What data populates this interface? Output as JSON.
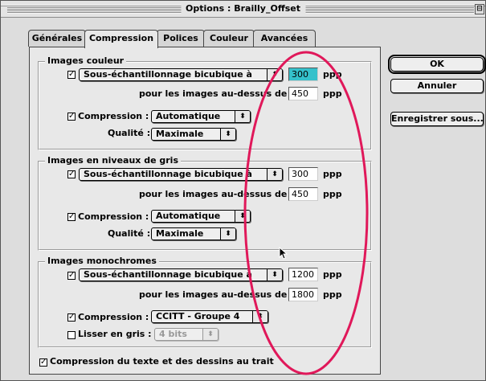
{
  "window": {
    "title": "Options : Brailly_Offset",
    "zoom_glyph": "⊟"
  },
  "tabs": [
    {
      "label": "Générales"
    },
    {
      "label": "Compression",
      "active": true
    },
    {
      "label": "Polices"
    },
    {
      "label": "Couleur"
    },
    {
      "label": "Avancées"
    }
  ],
  "color_images": {
    "title": "Images couleur",
    "resample_method": "Sous-échantillonnage bicubique à",
    "resample_value": "300",
    "unit": "ppp",
    "threshold_label": "pour les images au-dessus de :",
    "threshold_value": "450",
    "compression_label": "Compression :",
    "compression_value": "Automatique",
    "quality_label": "Qualité :",
    "quality_value": "Maximale"
  },
  "gray_images": {
    "title": "Images en niveaux de gris",
    "resample_method": "Sous-échantillonnage bicubique à",
    "resample_value": "300",
    "unit": "ppp",
    "threshold_label": "pour les images au-dessus de :",
    "threshold_value": "450",
    "compression_label": "Compression :",
    "compression_value": "Automatique",
    "quality_label": "Qualité :",
    "quality_value": "Maximale"
  },
  "mono_images": {
    "title": "Images monochromes",
    "resample_method": "Sous-échantillonnage bicubique à",
    "resample_value": "1200",
    "unit": "ppp",
    "threshold_label": "pour les images au-dessus de :",
    "threshold_value": "1800",
    "compression_label": "Compression :",
    "compression_value": "CCITT - Groupe 4",
    "smooth_label": "Lisser en gris :",
    "smooth_value": "4 bits"
  },
  "text_compression_label": "Compression du texte et des dessins au trait",
  "buttons": {
    "ok": "OK",
    "cancel": "Annuler",
    "save_as": "Enregistrer sous..."
  },
  "popup_arrow": "⬍",
  "colors": {
    "selection": "#35c1cb",
    "annotation_ellipse": "#e0185a"
  }
}
